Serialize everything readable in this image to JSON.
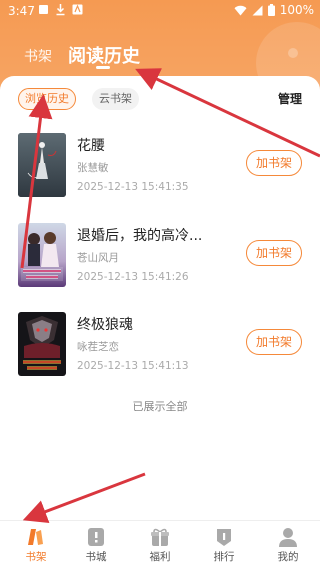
{
  "status_bar": {
    "time": "3:47",
    "battery": "100%",
    "icons": [
      "notification-icon",
      "download-icon",
      "font-icon",
      "wifi-icon",
      "signal-icon",
      "battery-icon"
    ]
  },
  "top_tabs": {
    "shelf_label": "书架",
    "history_label": "阅读历史"
  },
  "filters": {
    "browse_history": "浏览历史",
    "cloud_shelf": "云书架",
    "manage": "管理"
  },
  "books": [
    {
      "title": "花腰",
      "author": "张慧敏",
      "time": "2025-12-13 15:41:35",
      "add_label": "加书架"
    },
    {
      "title": "退婚后，我的高冷...",
      "author": "苍山风月",
      "time": "2025-12-13 15:41:26",
      "add_label": "加书架"
    },
    {
      "title": "终极狼魂",
      "author": "咏茬芝恋",
      "time": "2025-12-13 15:41:13",
      "add_label": "加书架"
    }
  ],
  "footer_text": "已展示全部",
  "bottom_nav": {
    "items": [
      {
        "label": "书架",
        "icon": "bookshelf-icon",
        "active": true
      },
      {
        "label": "书城",
        "icon": "bookstore-icon",
        "active": false
      },
      {
        "label": "福利",
        "icon": "gift-icon",
        "active": false
      },
      {
        "label": "排行",
        "icon": "ranking-icon",
        "active": false
      },
      {
        "label": "我的",
        "icon": "profile-icon",
        "active": false
      }
    ]
  },
  "colors": {
    "accent": "#f27a2a",
    "header": "#f59a52",
    "annotation_arrow": "#d9363e"
  }
}
